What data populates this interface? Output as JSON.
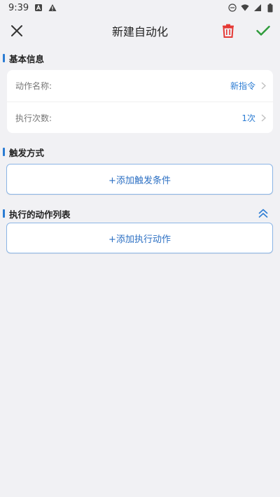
{
  "status_bar": {
    "time": "9:39"
  },
  "app_bar": {
    "title": "新建自动化",
    "close_icon": "close-icon",
    "delete_icon": "trash-icon",
    "confirm_icon": "check-icon",
    "delete_color": "#e53935",
    "confirm_color": "#2e9b3a"
  },
  "basic_info": {
    "header": "基本信息",
    "rows": [
      {
        "label": "动作名称:",
        "value": "新指令"
      },
      {
        "label": "执行次数:",
        "value": "1次"
      }
    ]
  },
  "trigger": {
    "header": "触发方式",
    "add_label": "+添加触发条件"
  },
  "actions": {
    "header": "执行的动作列表",
    "collapse_icon": "double-chevron-up-icon",
    "add_label": "+添加执行动作"
  },
  "colors": {
    "accent": "#2b7cd3",
    "background": "#f1f1f4"
  }
}
